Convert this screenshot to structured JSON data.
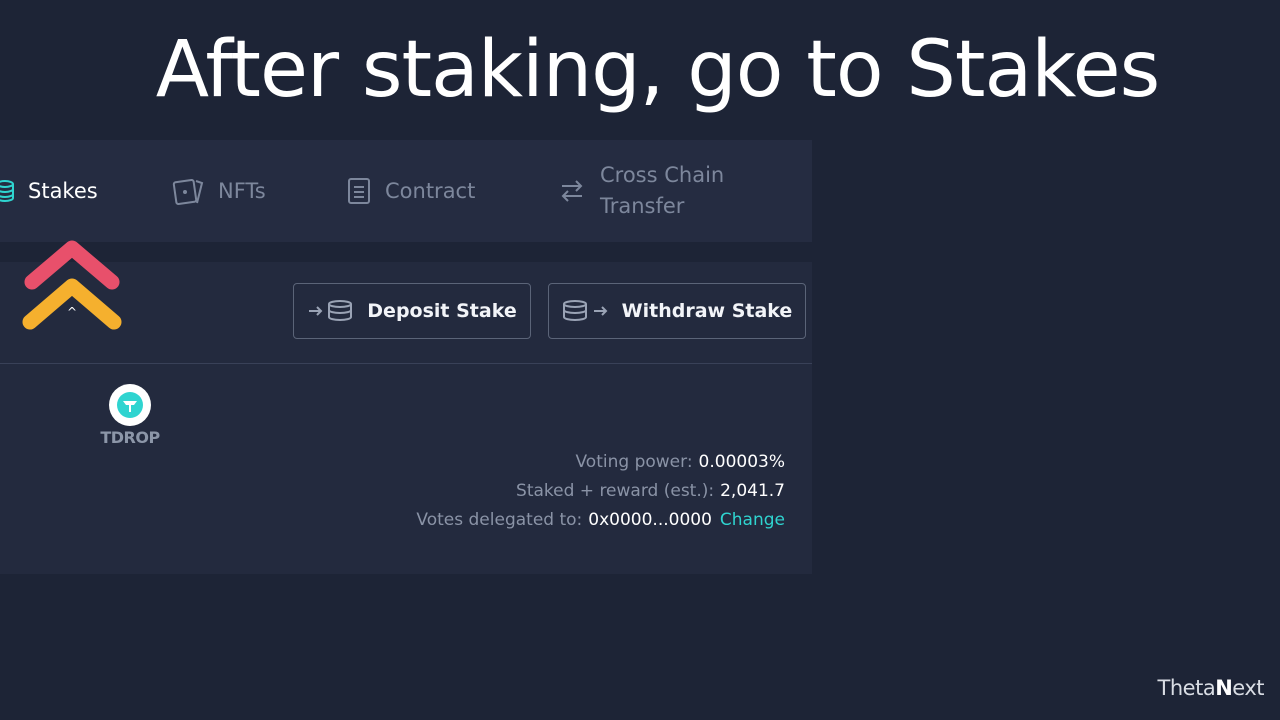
{
  "headline": "After staking, go to Stakes",
  "tabs": [
    {
      "label": "Stakes",
      "icon": "coins-icon",
      "active": true
    },
    {
      "label": "NFTs",
      "icon": "cards-icon",
      "active": false
    },
    {
      "label": "Contract",
      "icon": "document-icon",
      "active": false
    },
    {
      "label_line1": "Cross Chain",
      "label_line2": "Transfer",
      "icon": "swap-arrows-icon",
      "active": false
    }
  ],
  "buttons": {
    "deposit": "Deposit Stake",
    "withdraw": "Withdraw Stake"
  },
  "token": {
    "name": "TDROP"
  },
  "info": {
    "voting_power_label": "Voting power:",
    "voting_power_value": "0.00003%",
    "staked_label": "Staked + reward (est.):",
    "staked_value": "2,041.7",
    "delegated_label": "Votes delegated to:",
    "delegated_value": "0x0000...0000",
    "change_link": "Change"
  },
  "brand": {
    "prefix": "Theta",
    "bold": "N",
    "suffix": "ext"
  },
  "colors": {
    "background": "#1d2436",
    "panel": "#232a3e",
    "accent": "#2fd4d0",
    "chevron_top": "#e8506b",
    "chevron_bottom": "#f5b02e"
  }
}
